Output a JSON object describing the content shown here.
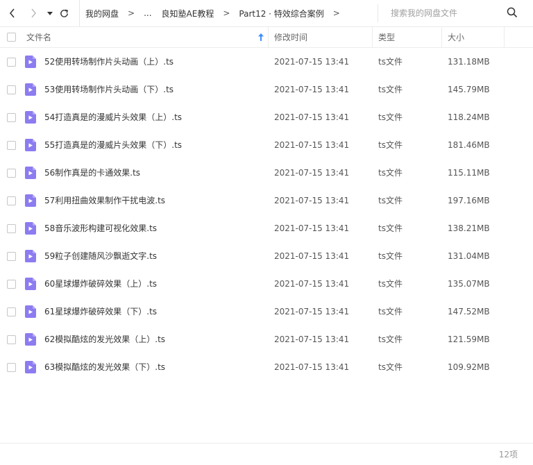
{
  "nav": {
    "back_icon": "chevron-left-icon",
    "forward_icon": "chevron-right-icon",
    "history_icon": "caret-down-icon",
    "refresh_icon": "refresh-icon"
  },
  "breadcrumb": {
    "root": "我的网盘",
    "ellipsis": "...",
    "folder": "良知塾AE教程",
    "current": "Part12 · 特效综合案例",
    "separator": ">"
  },
  "search": {
    "placeholder": "搜索我的网盘文件",
    "value": ""
  },
  "columns": {
    "name": "文件名",
    "modified": "修改时间",
    "type": "类型",
    "size": "大小",
    "sort_icon": "sort-ascending-arrow-icon"
  },
  "files": [
    {
      "name": "52使用转场制作片头动画（上）.ts",
      "modified": "2021-07-15 13:41",
      "type": "ts文件",
      "size": "131.18MB"
    },
    {
      "name": "53使用转场制作片头动画（下）.ts",
      "modified": "2021-07-15 13:41",
      "type": "ts文件",
      "size": "145.79MB"
    },
    {
      "name": "54打造真是的漫威片头效果（上）.ts",
      "modified": "2021-07-15 13:41",
      "type": "ts文件",
      "size": "118.24MB"
    },
    {
      "name": "55打造真是的漫威片头效果（下）.ts",
      "modified": "2021-07-15 13:41",
      "type": "ts文件",
      "size": "181.46MB"
    },
    {
      "name": "56制作真是的卡通效果.ts",
      "modified": "2021-07-15 13:41",
      "type": "ts文件",
      "size": "115.11MB"
    },
    {
      "name": "57利用扭曲效果制作干扰电波.ts",
      "modified": "2021-07-15 13:41",
      "type": "ts文件",
      "size": "197.16MB"
    },
    {
      "name": "58音乐波形构建可视化效果.ts",
      "modified": "2021-07-15 13:41",
      "type": "ts文件",
      "size": "138.21MB"
    },
    {
      "name": "59粒子创建随风沙飘逝文字.ts",
      "modified": "2021-07-15 13:41",
      "type": "ts文件",
      "size": "131.04MB"
    },
    {
      "name": "60星球爆炸破碎效果（上）.ts",
      "modified": "2021-07-15 13:41",
      "type": "ts文件",
      "size": "135.07MB"
    },
    {
      "name": "61星球爆炸破碎效果（下）.ts",
      "modified": "2021-07-15 13:41",
      "type": "ts文件",
      "size": "147.52MB"
    },
    {
      "name": "62模拟酷炫的发光效果（上）.ts",
      "modified": "2021-07-15 13:41",
      "type": "ts文件",
      "size": "121.59MB"
    },
    {
      "name": "63模拟酷炫的发光效果（下）.ts",
      "modified": "2021-07-15 13:41",
      "type": "ts文件",
      "size": "109.92MB"
    }
  ],
  "file_icon": "video-file-icon",
  "footer": {
    "count": "12项"
  },
  "colors": {
    "accent": "#3b8cff",
    "file_icon": "#8c7cf0",
    "divider": "#ececec"
  }
}
